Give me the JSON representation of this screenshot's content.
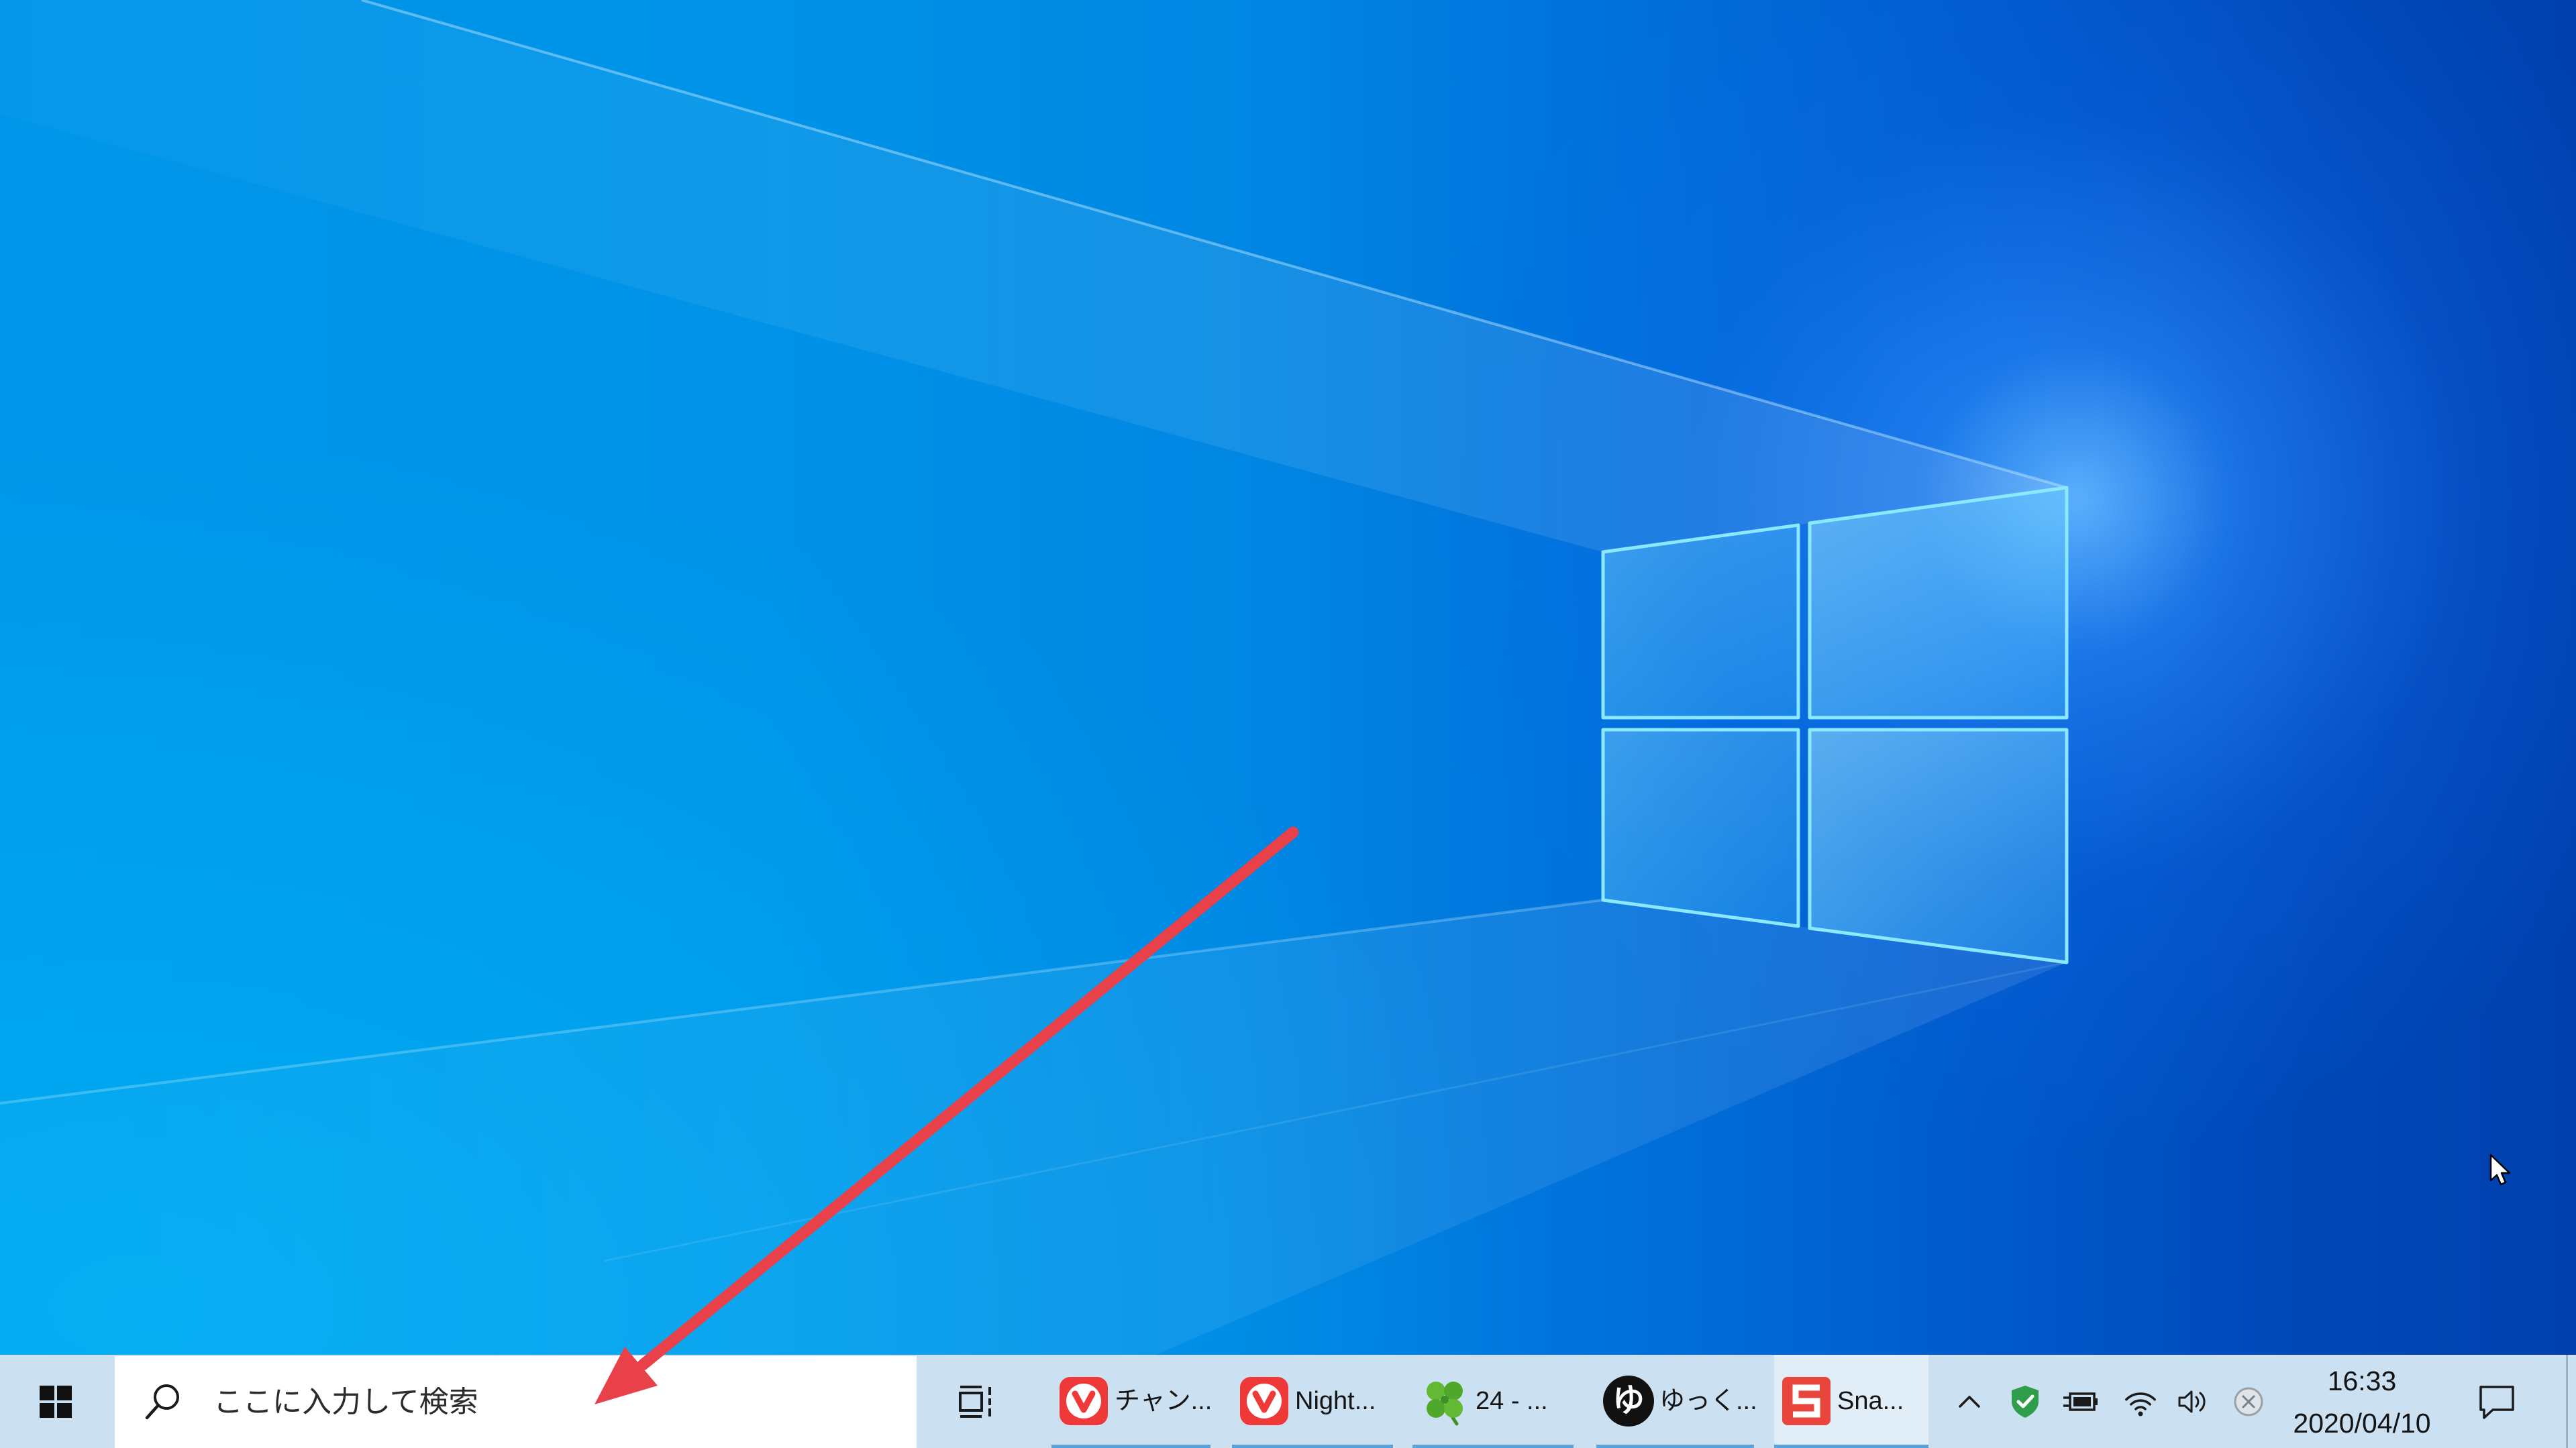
{
  "desktop": {
    "logo_icon": "windows-logo-icon",
    "cursor_icon": "mouse-pointer-icon"
  },
  "taskbar": {
    "start": {
      "icon": "windows-start-icon"
    },
    "search": {
      "icon": "search-icon",
      "placeholder": "ここに入力して検索"
    },
    "task_view": {
      "icon": "task-view-icon"
    },
    "apps": [
      {
        "label": "チャン...",
        "icon": "vivaldi-icon",
        "running": true,
        "active": false
      },
      {
        "label": "Night...",
        "icon": "vivaldi-icon",
        "running": true,
        "active": false
      },
      {
        "label": "24 - ...",
        "icon": "clover-icon",
        "running": true,
        "active": false
      },
      {
        "label": "ゆっく...",
        "icon": "yukkuri-icon",
        "glyph": "ゆ",
        "running": true,
        "active": false
      },
      {
        "label": "Sna...",
        "icon": "snagit-icon",
        "running": true,
        "active": true
      }
    ],
    "tray": {
      "icons": [
        "chevron-up-icon",
        "shield-icon",
        "power-battery-icon",
        "wifi-icon",
        "volume-icon",
        "close-circle-icon"
      ],
      "clock": {
        "time": "16:33",
        "date": "2020/04/10"
      },
      "notification": {
        "icon": "notification-icon"
      }
    }
  },
  "colors": {
    "taskbar_bg": "#cbe0f1",
    "search_bg": "#ffffff",
    "running_indicator": "#5aa2dc",
    "arrow": "#e8414a"
  }
}
